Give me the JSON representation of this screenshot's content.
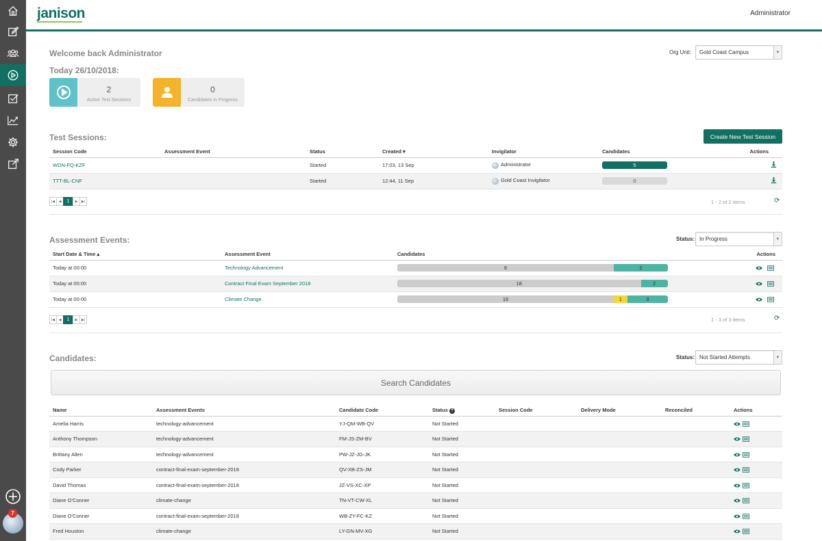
{
  "header": {
    "logo": "janison",
    "user": "Administrator"
  },
  "sidebar": {
    "items": [
      {
        "icon": "home-icon"
      },
      {
        "icon": "edit-icon"
      },
      {
        "icon": "users-icon"
      },
      {
        "icon": "play-icon",
        "active": true
      },
      {
        "icon": "checklist-icon"
      },
      {
        "icon": "chart-icon"
      },
      {
        "icon": "gear-icon"
      },
      {
        "icon": "external-edit-icon"
      }
    ],
    "notification_count": "7"
  },
  "welcome": {
    "title": "Welcome back Administrator",
    "today": "Today 26/10/2018:",
    "org_unit_label": "Org Unit:",
    "org_unit_value": "Gold Coast Campus"
  },
  "stats": [
    {
      "value": "2",
      "label": "Active Test Sessions",
      "color": "#5fc2c8"
    },
    {
      "value": "0",
      "label": "Candidates in Progress",
      "color": "#f4b32b"
    }
  ],
  "test_sessions": {
    "title": "Test Sessions:",
    "create_label": "Create New Test Session",
    "columns": [
      "Session Code",
      "Assessment Event",
      "Status",
      "Created ▾",
      "Invigilator",
      "Candidates",
      "Actions"
    ],
    "rows": [
      {
        "code": "WDN-FQ-KZF",
        "event": "",
        "status": "Started",
        "created": "17:03, 13 Sep",
        "invigilator": "Administrator",
        "candidates": "5"
      },
      {
        "code": "TTT-BL-CNF",
        "event": "",
        "status": "Started",
        "created": "12:44, 11 Sep",
        "invigilator": "Gold Coast Invigilator",
        "candidates": "0"
      }
    ],
    "page": "1",
    "page_info": "1 - 2 of 2 items"
  },
  "assessment_events": {
    "title": "Assessment Events:",
    "status_label": "Status:",
    "status_value": "In Progress",
    "columns": [
      "Start Date & Time ▴",
      "Assessment Event",
      "Candidates",
      "Actions"
    ],
    "rows": [
      {
        "start": "Today at 00:00",
        "event": "Technology Advancement",
        "not_started": 8,
        "in_progress": 0,
        "completed": 2
      },
      {
        "start": "Today at 00:00",
        "event": "Contract Final Exam September 2018",
        "not_started": 18,
        "in_progress": 0,
        "completed": 2
      },
      {
        "start": "Today at 00:00",
        "event": "Climate Change",
        "not_started": 16,
        "in_progress": 1,
        "completed": 3
      }
    ],
    "page": "1",
    "page_info": "1 - 3 of 3 items"
  },
  "candidates": {
    "title": "Candidates:",
    "status_label": "Status:",
    "status_value": "Not Started Attempts",
    "search_label": "Search Candidates",
    "columns": [
      "Name",
      "Assessment Events",
      "Candidate Code",
      "Status",
      "Session Code",
      "Delivery Mode",
      "Reconciled",
      "Actions"
    ],
    "rows": [
      {
        "name": "Amelia Harris",
        "event": "technology-advancement",
        "code": "YJ-QM-WB-QV",
        "status": "Not Started"
      },
      {
        "name": "Anthony Thompson",
        "event": "technology-advancement",
        "code": "FM-JS-ZM-BV",
        "status": "Not Started"
      },
      {
        "name": "Brittany Allen",
        "event": "technology-advancement",
        "code": "PW-JZ-JG-JK",
        "status": "Not Started"
      },
      {
        "name": "Cody Parker",
        "event": "contract-final-exam-september-2018",
        "code": "QV-XB-ZS-JM",
        "status": "Not Started"
      },
      {
        "name": "David Thomas",
        "event": "contract-final-exam-september-2018",
        "code": "JZ-VS-XC-XP",
        "status": "Not Started"
      },
      {
        "name": "Diane O'Conner",
        "event": "climate-change",
        "code": "TN-VT-CW-XL",
        "status": "Not Started"
      },
      {
        "name": "Diane O'Conner",
        "event": "contract-final-exam-september-2018",
        "code": "WB-ZY-FC-KZ",
        "status": "Not Started"
      },
      {
        "name": "Fred Houston",
        "event": "climate-change",
        "code": "LY-GN-MV-XG",
        "status": "Not Started"
      }
    ]
  },
  "colors": {
    "brand": "#117061",
    "teal_light": "#4db3a2",
    "bar_grey": "#cccccc",
    "in_progress_yellow": "#f2d53c"
  }
}
